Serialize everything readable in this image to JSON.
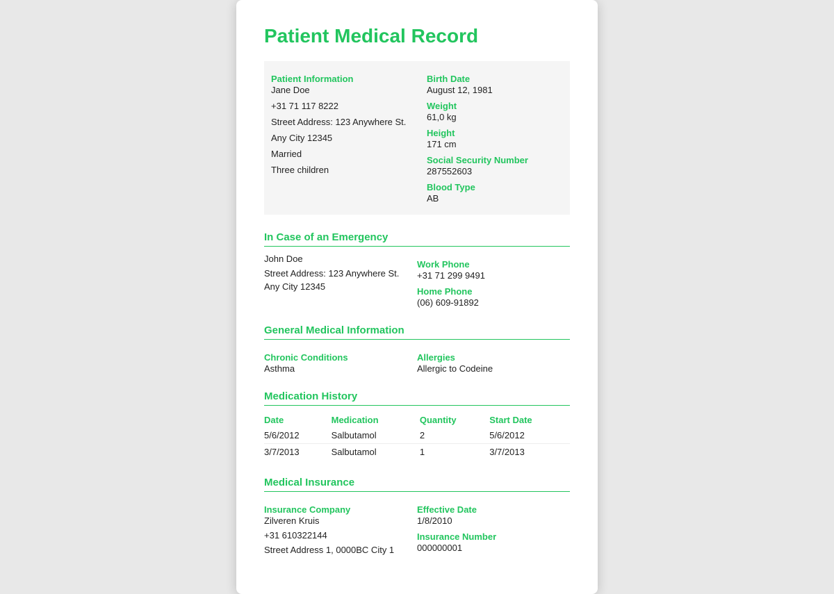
{
  "page": {
    "title": "Patient Medical Record"
  },
  "patient_info": {
    "section_label": "Patient Information",
    "name": "Jane Doe",
    "phone": "+31 71 117 8222",
    "street_address": "Street Address: 123 Anywhere St.",
    "city": "Any City 12345",
    "marital_status": "Married",
    "children": "Three children"
  },
  "vital_info": {
    "birth_date_label": "Birth Date",
    "birth_date": "August 12, 1981",
    "weight_label": "Weight",
    "weight": "61,0 kg",
    "height_label": "Height",
    "height": "171 cm",
    "ssn_label": "Social Security Number",
    "ssn": "287552603",
    "blood_type_label": "Blood Type",
    "blood_type": "AB"
  },
  "emergency": {
    "section_label": "In Case of an Emergency",
    "name": "John Doe",
    "street_address": "Street Address: 123 Anywhere St.",
    "city": "Any City 12345",
    "work_phone_label": "Work Phone",
    "work_phone": "+31 71 299 9491",
    "home_phone_label": "Home Phone",
    "home_phone": "(06) 609-91892"
  },
  "general_medical": {
    "section_label": "General Medical Information",
    "chronic_label": "Chronic Conditions",
    "chronic_value": "Asthma",
    "allergies_label": "Allergies",
    "allergies_value": "Allergic to Codeine"
  },
  "medication_history": {
    "section_label": "Medication History",
    "columns": {
      "date": "Date",
      "medication": "Medication",
      "quantity": "Quantity",
      "start_date": "Start Date"
    },
    "rows": [
      {
        "date": "5/6/2012",
        "medication": "Salbutamol",
        "quantity": "2",
        "start_date": "5/6/2012"
      },
      {
        "date": "3/7/2013",
        "medication": "Salbutamol",
        "quantity": "1",
        "start_date": "3/7/2013"
      }
    ]
  },
  "insurance": {
    "section_label": "Medical Insurance",
    "company_label": "Insurance Company",
    "company_name": "Zilveren Kruis",
    "phone": "+31 610322144",
    "address": "Street Address 1, 0000BC City 1",
    "effective_date_label": "Effective Date",
    "effective_date": "1/8/2010",
    "insurance_number_label": "Insurance Number",
    "insurance_number": "000000001"
  }
}
